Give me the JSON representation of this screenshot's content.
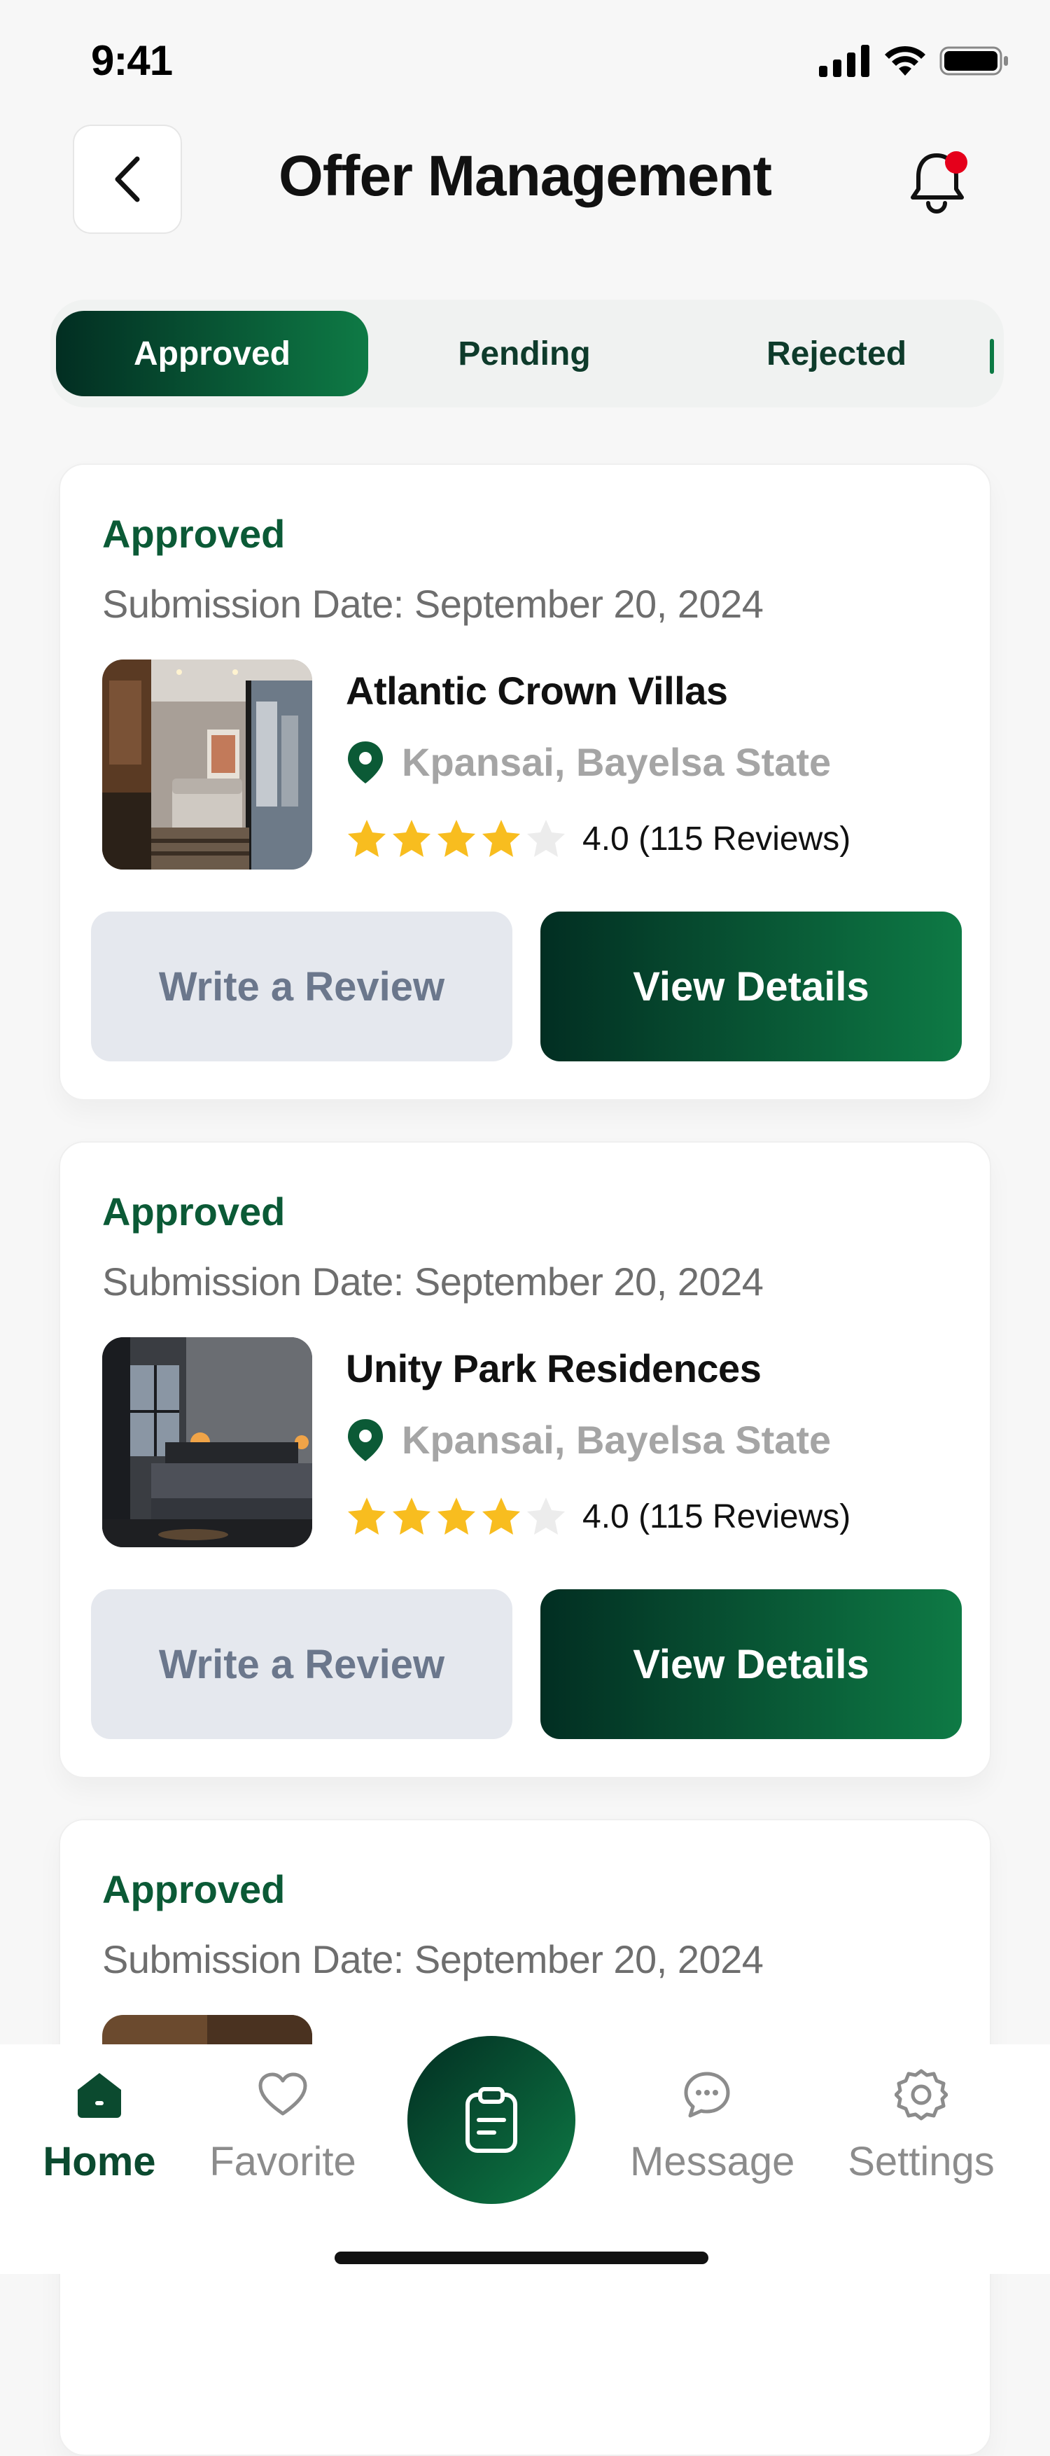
{
  "status_bar": {
    "time": "9:41"
  },
  "header": {
    "title": "Offer Management"
  },
  "tabs": [
    {
      "label": "Approved",
      "active": true
    },
    {
      "label": "Pending",
      "active": false
    },
    {
      "label": "Rejected",
      "active": false
    }
  ],
  "offers": [
    {
      "status": "Approved",
      "submission_date": "Submission Date: September 20, 2024",
      "name": "Atlantic Crown Villas",
      "location": "Kpansai, Bayelsa State",
      "rating": 4.0,
      "rating_text": "4.0 (115 Reviews)",
      "review_button": "Write a Review",
      "details_button": "View Details"
    },
    {
      "status": "Approved",
      "submission_date": "Submission Date: September 20, 2024",
      "name": "Unity Park Residences",
      "location": "Kpansai, Bayelsa State",
      "rating": 4.0,
      "rating_text": "4.0 (115 Reviews)",
      "review_button": "Write a Review",
      "details_button": "View Details"
    },
    {
      "status": "Approved",
      "submission_date": "Submission Date: September 20, 2024"
    }
  ],
  "bottom_nav": {
    "items": [
      {
        "label": "Home",
        "icon": "home-icon",
        "active": true
      },
      {
        "label": "Favorite",
        "icon": "heart-icon",
        "active": false
      },
      {
        "label": "Message",
        "icon": "chat-icon",
        "active": false
      },
      {
        "label": "Settings",
        "icon": "gear-icon",
        "active": false
      }
    ],
    "center_icon": "clipboard-icon"
  },
  "colors": {
    "brand_dark": "#022e22",
    "brand_green": "#0e7a45",
    "status_text": "#0b5a36",
    "star": "#f8bd1f",
    "notification_dot": "#e5001b"
  }
}
